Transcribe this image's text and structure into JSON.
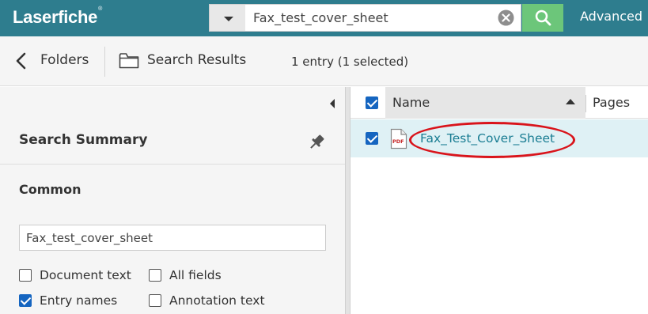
{
  "app": {
    "logo_text": "Laserfiche",
    "logo_mark": "®"
  },
  "search": {
    "query": "Fax_test_cover_sheet",
    "advanced_label": "Advanced"
  },
  "breadcrumb": {
    "back_label": "Folders",
    "current_label": "Search Results",
    "entry_count": "1 entry (1 selected)"
  },
  "summary": {
    "title": "Search Summary",
    "section_title": "Common",
    "name_value": "Fax_test_cover_sheet",
    "options": [
      {
        "label": "Document text",
        "checked": false
      },
      {
        "label": "All fields",
        "checked": false
      },
      {
        "label": "Entry names",
        "checked": true
      },
      {
        "label": "Annotation text",
        "checked": false
      }
    ]
  },
  "results": {
    "columns": {
      "name": "Name",
      "pages": "Pages"
    },
    "rows": [
      {
        "name": "Fax_Test_Cover_Sheet",
        "icon_text": "PDF",
        "selected": true
      }
    ]
  },
  "colors": {
    "topbar": "#2e7d8e",
    "search_button": "#6cc67a",
    "checkbox": "#1565c0",
    "link": "#1a7d93",
    "selected_row": "#dff1f5",
    "annotation": "#d9141b"
  }
}
